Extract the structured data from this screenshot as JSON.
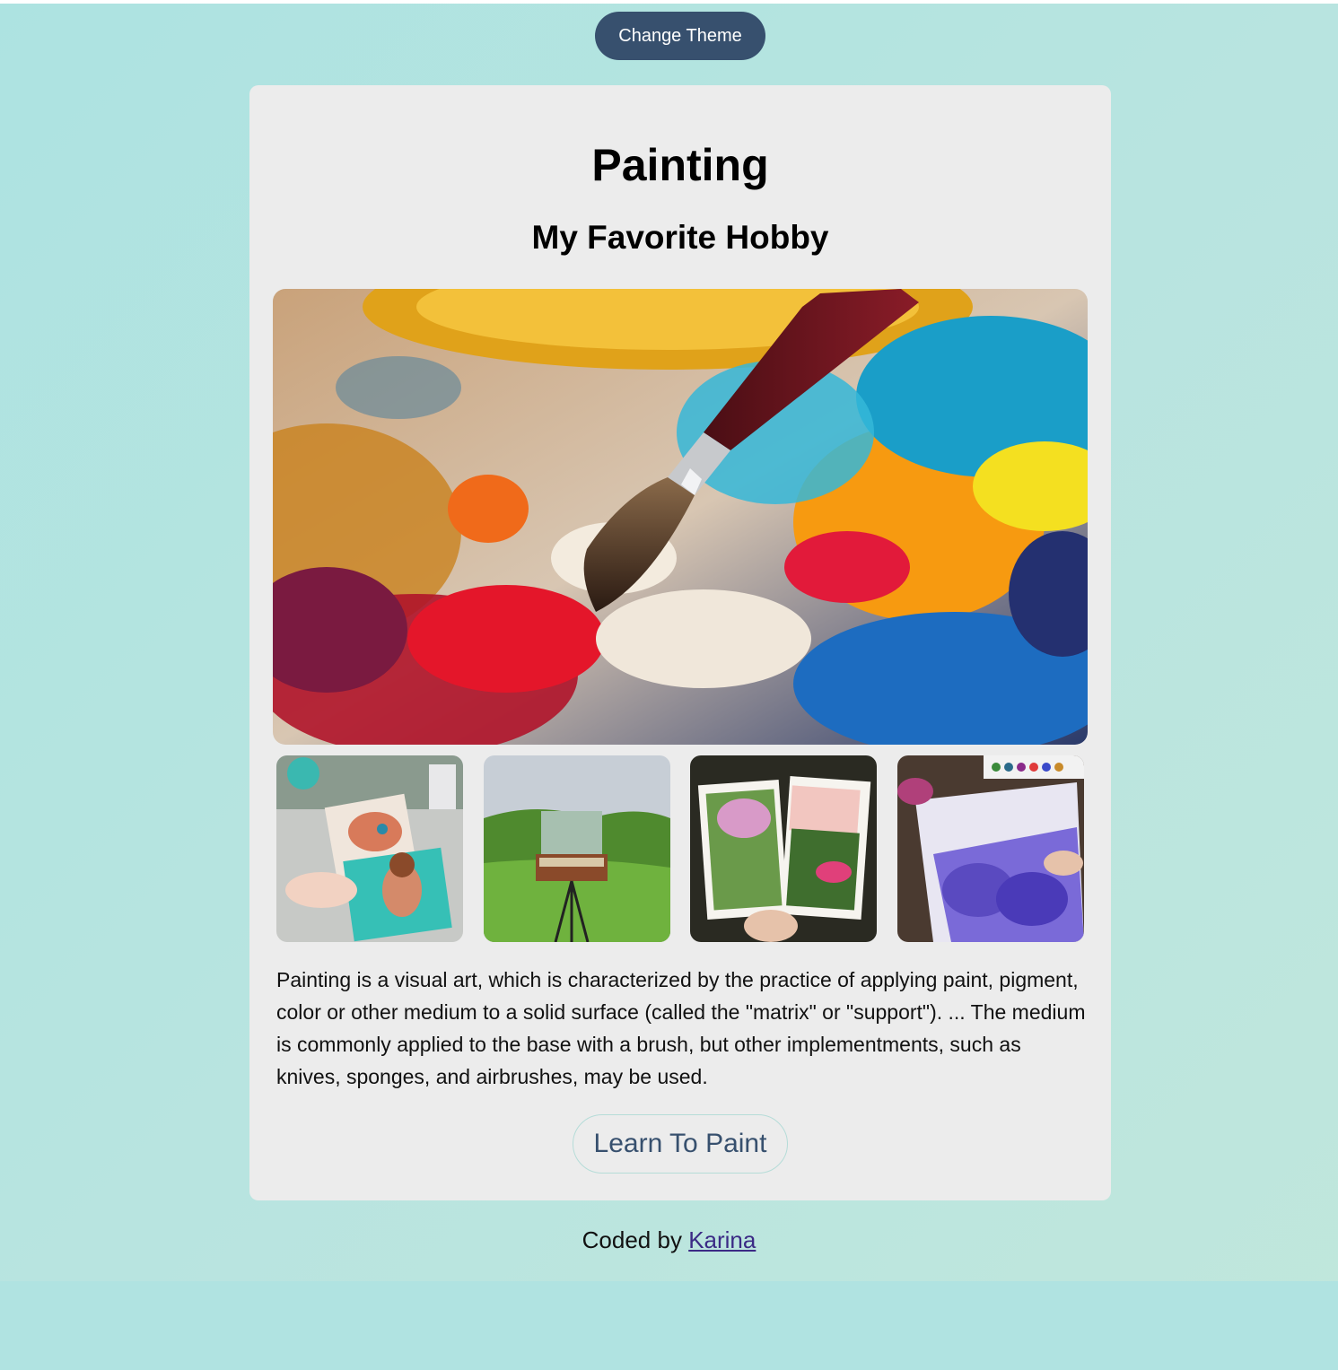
{
  "header": {
    "theme_button_label": "Change Theme"
  },
  "card": {
    "title": "Painting",
    "subtitle": "My Favorite Hobby",
    "description": "Painting is a visual art, which is characterized by the practice of applying paint, pigment, color or other medium to a solid surface (called the \"matrix\" or \"support\"). ... The medium is commonly applied to the base with a brush, but other implementments, such as knives, sponges, and airbrushes, may be used.",
    "learn_button_label": "Learn To Paint"
  },
  "footer": {
    "prefix": "Coded by",
    "author": "Karina"
  },
  "colors": {
    "accent": "#37506e",
    "card_bg": "#ececec",
    "link": "#3b2a85"
  }
}
